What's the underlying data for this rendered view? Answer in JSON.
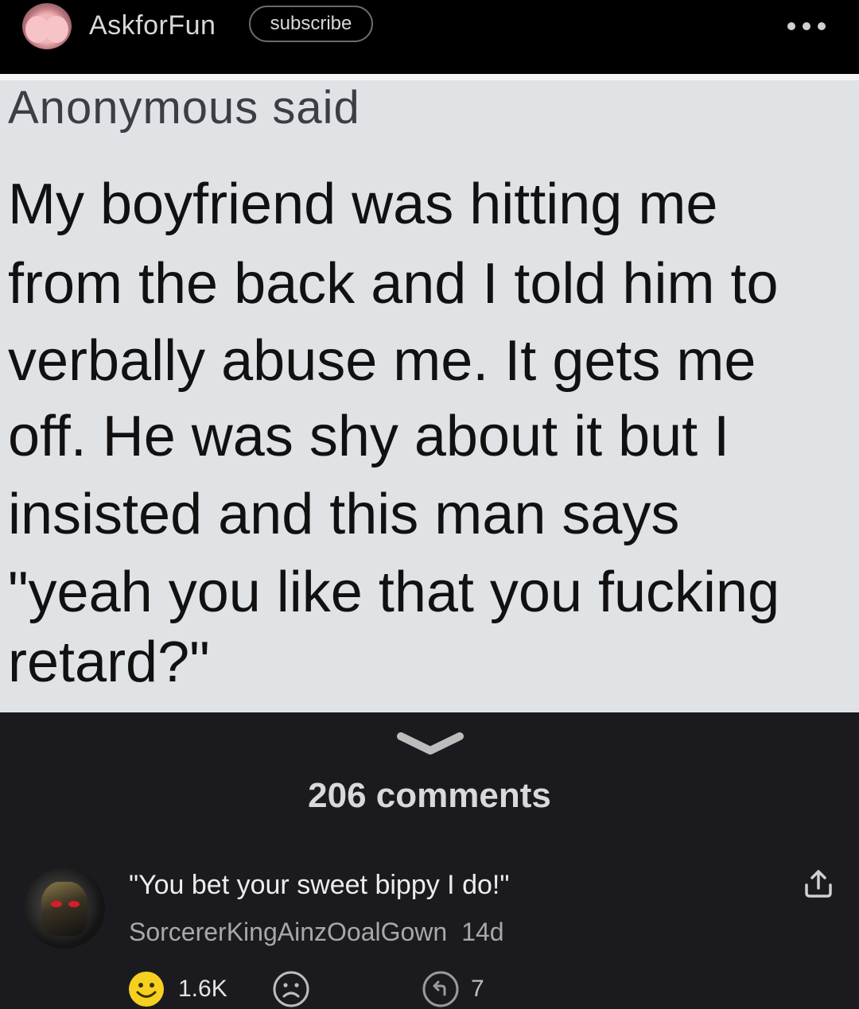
{
  "header": {
    "channel_name": "AskforFun",
    "subscribe_label": "subscribe",
    "icons": {
      "avatar": "channel-avatar",
      "more": "more-dots-icon"
    }
  },
  "post": {
    "heading": "Anonymous said",
    "lines": [
      "My boyfriend was hitting me",
      "from the back and I told him to",
      "verbally abuse me. It gets me",
      "off. He was shy about it but I",
      "insisted and this man says",
      "\"yeah you like that you fucking",
      "retard?\""
    ]
  },
  "comments": {
    "count_label": "206 comments",
    "top_comment": {
      "text": "\"You bet your sweet bippy I do!\"",
      "author": "SorcererKingAinzOoalGown",
      "age": "14d",
      "likes": "1.6K",
      "replies": "7",
      "icons": {
        "share": "share-icon",
        "like": "happy-face-icon",
        "dislike": "sad-face-icon",
        "reply": "reply-icon"
      }
    }
  },
  "colors": {
    "page_bg": "#1b1a1f",
    "header_bg": "#000000",
    "post_bg": "#dfe3e6",
    "like_yellow": "#f5d020"
  }
}
